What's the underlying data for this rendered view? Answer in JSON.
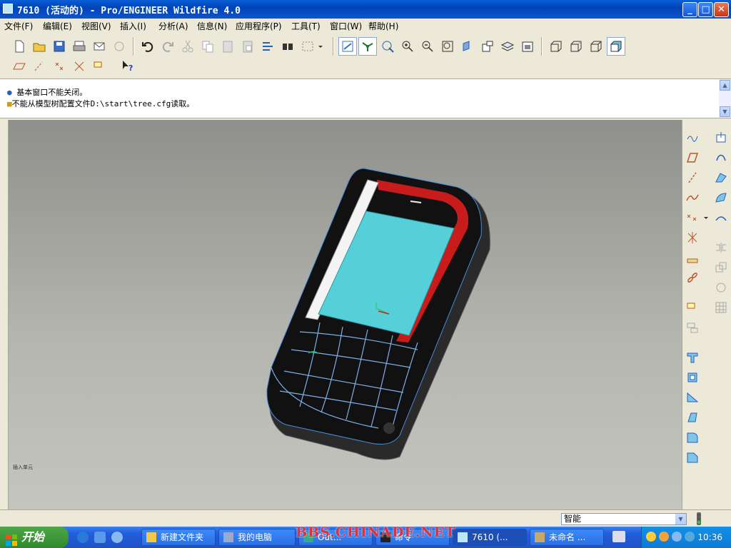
{
  "window": {
    "title": "7610 (活动的) - Pro/ENGINEER Wildfire 4.0",
    "minimize": "_",
    "maximize": "□",
    "close": "✕"
  },
  "menu": [
    "文件(F)",
    "编辑(E)",
    "视图(V)",
    "插入(I)",
    "分析(A)",
    "信息(N)",
    "应用程序(P)",
    "工具(T)",
    "窗口(W)",
    "帮助(H)"
  ],
  "messages": [
    "基本窗口不能关闭。",
    "不能从模型树配置文件D:\\start\\tree.cfg读取。"
  ],
  "graphics": {
    "corner_label": "插入单元"
  },
  "status": {
    "filter_value": "智能"
  },
  "taskbar": {
    "start": "开始",
    "tasks": [
      "新建文件夹",
      "我的电脑",
      "Out...",
      "命令",
      "7610 (...",
      "未命名 ..."
    ],
    "clock": "10:36",
    "watermark": "BBS.CHINADE.NET"
  },
  "colors": {
    "accent": "#0a5fd8",
    "screen": "#55d0d8",
    "phone_body": "#111111",
    "accent_red": "#c81c1c"
  }
}
